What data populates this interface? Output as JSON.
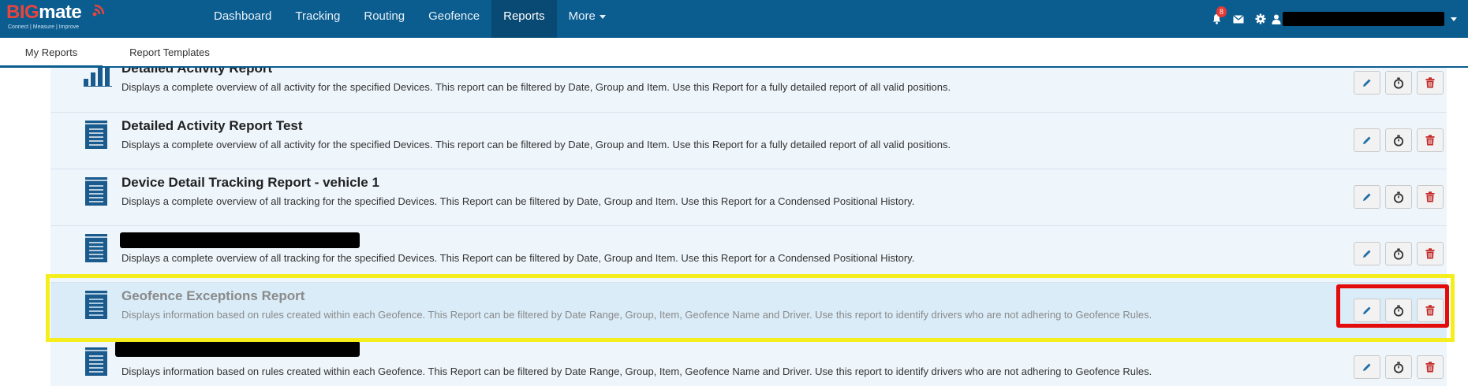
{
  "brand": {
    "big": "BIG",
    "mate": "mate",
    "tagline": "Connect | Measure | Improve"
  },
  "nav": {
    "items": [
      {
        "label": "Dashboard"
      },
      {
        "label": "Tracking"
      },
      {
        "label": "Routing"
      },
      {
        "label": "Geofence"
      },
      {
        "label": "Reports"
      },
      {
        "label": "More"
      }
    ],
    "active": "Reports"
  },
  "notifications": {
    "count": "8"
  },
  "tabs": [
    {
      "label": "My Reports"
    },
    {
      "label": "Report Templates"
    }
  ],
  "reports": [
    {
      "title": "Detailed Activity Report",
      "desc": "Displays a complete overview of all activity for the specified Devices. This report can be filtered by Date, Group and Item. Use this Report for a fully detailed report of all valid positions.",
      "icon": "bar-chart-icon"
    },
    {
      "title": "Detailed Activity Report Test",
      "desc": "Displays a complete overview of all activity for the specified Devices. This report can be filtered by Date, Group and Item. Use this Report for a fully detailed report of all valid positions.",
      "icon": "document-icon"
    },
    {
      "title": "Device Detail Tracking Report - vehicle 1",
      "desc": "Displays a complete overview of all tracking for the specified Devices. This Report can be filtered by Date, Group and Item. Use this Report for a Condensed Positional History.",
      "icon": "document-icon"
    },
    {
      "title": "",
      "desc": "Displays a complete overview of all tracking for the specified Devices. This Report can be filtered by Date, Group and Item. Use this Report for a Condensed Positional History.",
      "icon": "document-icon"
    },
    {
      "title": "Geofence Exceptions Report",
      "desc": "Displays information based on rules created within each Geofence. This Report can be filtered by Date Range, Group, Item, Geofence Name and Driver. Use this report to identify drivers who are not adhering to Geofence Rules.",
      "icon": "document-icon"
    },
    {
      "title": "",
      "desc": "Displays information based on rules created within each Geofence. This Report can be filtered by Date Range, Group, Item, Geofence Name and Driver. Use this report to identify drivers who are not adhering to Geofence Rules.",
      "icon": "document-icon"
    }
  ],
  "colors": {
    "navbar": "#0b5c8f",
    "edit": "#1f6fa8",
    "schedule": "#333333",
    "delete": "#c62828",
    "highlight_yellow": "#f5ee1c",
    "highlight_red": "#e30b0b"
  }
}
